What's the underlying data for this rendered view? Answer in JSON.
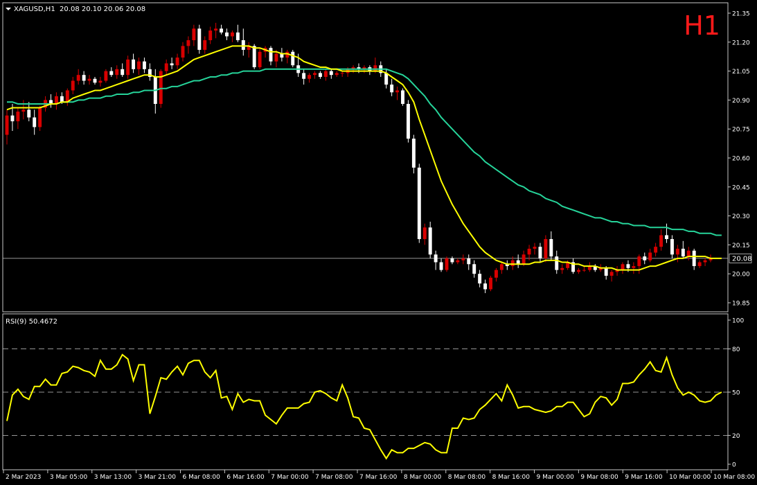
{
  "header": {
    "symbol_info": "XAGUSD,H1  20.08 20.10 20.06 20.08"
  },
  "timeframe_label": "H1",
  "rsi_header": "RSI(9) 50.4672",
  "colors": {
    "background": "#000000",
    "frame": "#c8c8c8",
    "text": "#ffffff",
    "bull_candle": "#d80000",
    "bear_candle": "#ffffff",
    "ma_fast": "#ffff00",
    "ma_slow": "#26d49a",
    "rsi_line": "#ffff00",
    "timeframe_label": "#ff1a1a",
    "price_line": "#c8c8c8"
  },
  "chart_data": [
    {
      "type": "candlestick",
      "symbol": "XAGUSD",
      "timeframe": "H1",
      "ylim": [
        19.78,
        21.42
      ],
      "y_ticks": [
        "21.35",
        "21.20",
        "21.05",
        "20.90",
        "20.75",
        "20.60",
        "20.45",
        "20.30",
        "20.15",
        "20.00",
        "19.85"
      ],
      "current_price": "20.08",
      "x_labels": [
        "2 Mar 2023",
        "3 Mar 05:00",
        "3 Mar 13:00",
        "3 Mar 21:00",
        "6 Mar 08:00",
        "6 Mar 16:00",
        "7 Mar 00:00",
        "7 Mar 08:00",
        "7 Mar 16:00",
        "8 Mar 00:00",
        "8 Mar 08:00",
        "8 Mar 16:00",
        "9 Mar 00:00",
        "9 Mar 08:00",
        "9 Mar 16:00",
        "10 Mar 00:00",
        "10 Mar 08:00"
      ],
      "candles": [
        [
          20.72,
          20.85,
          20.67,
          20.82
        ],
        [
          20.82,
          20.88,
          20.74,
          20.79
        ],
        [
          20.79,
          20.86,
          20.75,
          20.84
        ],
        [
          20.84,
          20.9,
          20.8,
          20.85
        ],
        [
          20.85,
          20.89,
          20.79,
          20.81
        ],
        [
          20.81,
          20.85,
          20.72,
          20.76
        ],
        [
          20.76,
          20.87,
          20.74,
          20.86
        ],
        [
          20.86,
          20.92,
          20.84,
          20.9
        ],
        [
          20.9,
          20.93,
          20.86,
          20.88
        ],
        [
          20.88,
          20.94,
          20.85,
          20.92
        ],
        [
          20.92,
          20.94,
          20.88,
          20.89
        ],
        [
          20.89,
          20.96,
          20.87,
          20.95
        ],
        [
          20.95,
          21.02,
          20.93,
          21.0
        ],
        [
          21.0,
          21.06,
          20.98,
          21.03
        ],
        [
          21.03,
          21.05,
          20.98,
          21.0
        ],
        [
          21.0,
          21.03,
          20.98,
          21.01
        ],
        [
          21.01,
          21.02,
          20.98,
          20.99
        ],
        [
          20.99,
          21.02,
          20.97,
          21.0
        ],
        [
          21.0,
          21.06,
          20.99,
          21.05
        ],
        [
          21.05,
          21.07,
          21.02,
          21.03
        ],
        [
          21.03,
          21.08,
          21.01,
          21.06
        ],
        [
          21.06,
          21.09,
          21.02,
          21.03
        ],
        [
          21.03,
          21.13,
          21.01,
          21.11
        ],
        [
          21.11,
          21.14,
          21.04,
          21.06
        ],
        [
          21.06,
          21.12,
          21.03,
          21.1
        ],
        [
          21.1,
          21.12,
          21.04,
          21.06
        ],
        [
          21.06,
          21.09,
          21.0,
          21.02
        ],
        [
          21.02,
          21.06,
          20.83,
          20.88
        ],
        [
          20.88,
          21.06,
          20.86,
          21.05
        ],
        [
          21.05,
          21.11,
          21.03,
          21.09
        ],
        [
          21.09,
          21.12,
          21.06,
          21.08
        ],
        [
          21.08,
          21.14,
          21.06,
          21.12
        ],
        [
          21.12,
          21.2,
          21.1,
          21.18
        ],
        [
          21.18,
          21.23,
          21.14,
          21.21
        ],
        [
          21.21,
          21.29,
          21.18,
          21.27
        ],
        [
          21.27,
          21.29,
          21.14,
          21.16
        ],
        [
          21.16,
          21.23,
          21.14,
          21.21
        ],
        [
          21.21,
          21.28,
          21.19,
          21.26
        ],
        [
          21.26,
          21.3,
          21.22,
          21.27
        ],
        [
          21.27,
          21.29,
          21.24,
          21.25
        ],
        [
          21.25,
          21.27,
          21.21,
          21.23
        ],
        [
          21.23,
          21.26,
          21.2,
          21.25
        ],
        [
          21.25,
          21.29,
          21.2,
          21.21
        ],
        [
          21.21,
          21.27,
          21.13,
          21.16
        ],
        [
          21.16,
          21.2,
          21.12,
          21.18
        ],
        [
          21.18,
          21.19,
          21.06,
          21.07
        ],
        [
          21.07,
          21.17,
          21.06,
          21.15
        ],
        [
          21.15,
          21.18,
          21.12,
          21.17
        ],
        [
          21.17,
          21.18,
          21.08,
          21.1
        ],
        [
          21.1,
          21.16,
          21.07,
          21.14
        ],
        [
          21.14,
          21.17,
          21.1,
          21.12
        ],
        [
          21.12,
          21.16,
          21.09,
          21.15
        ],
        [
          21.15,
          21.16,
          21.07,
          21.08
        ],
        [
          21.08,
          21.14,
          21.02,
          21.04
        ],
        [
          21.04,
          21.06,
          20.98,
          21.01
        ],
        [
          21.01,
          21.04,
          20.99,
          21.03
        ],
        [
          21.03,
          21.05,
          21.01,
          21.04
        ],
        [
          21.04,
          21.05,
          21.01,
          21.02
        ],
        [
          21.02,
          21.06,
          21.0,
          21.05
        ],
        [
          21.05,
          21.06,
          21.01,
          21.03
        ],
        [
          21.03,
          21.05,
          21.02,
          21.04
        ],
        [
          21.04,
          21.05,
          21.02,
          21.04
        ],
        [
          21.04,
          21.07,
          21.02,
          21.06
        ],
        [
          21.06,
          21.08,
          21.04,
          21.07
        ],
        [
          21.07,
          21.09,
          21.04,
          21.06
        ],
        [
          21.06,
          21.08,
          21.04,
          21.07
        ],
        [
          21.07,
          21.08,
          21.03,
          21.05
        ],
        [
          21.05,
          21.12,
          21.04,
          21.08
        ],
        [
          21.08,
          21.1,
          21.02,
          21.04
        ],
        [
          21.04,
          21.06,
          20.96,
          20.98
        ],
        [
          20.98,
          21.01,
          20.92,
          20.94
        ],
        [
          20.94,
          20.97,
          20.9,
          20.95
        ],
        [
          20.95,
          20.96,
          20.87,
          20.88
        ],
        [
          20.88,
          20.9,
          20.68,
          20.7
        ],
        [
          20.7,
          20.72,
          20.52,
          20.55
        ],
        [
          20.55,
          20.57,
          20.16,
          20.18
        ],
        [
          20.18,
          20.26,
          20.15,
          20.24
        ],
        [
          20.24,
          20.27,
          20.08,
          20.1
        ],
        [
          20.1,
          20.12,
          20.02,
          20.06
        ],
        [
          20.06,
          20.08,
          20.01,
          20.02
        ],
        [
          20.02,
          20.09,
          20.01,
          20.08
        ],
        [
          20.08,
          20.09,
          20.05,
          20.06
        ],
        [
          20.06,
          20.08,
          20.05,
          20.07
        ],
        [
          20.07,
          20.1,
          20.05,
          20.08
        ],
        [
          20.08,
          20.1,
          20.02,
          20.05
        ],
        [
          20.05,
          20.07,
          19.98,
          20.0
        ],
        [
          20.0,
          20.02,
          19.93,
          19.95
        ],
        [
          19.95,
          19.97,
          19.9,
          19.92
        ],
        [
          19.92,
          19.99,
          19.91,
          19.98
        ],
        [
          19.98,
          20.03,
          19.96,
          20.02
        ],
        [
          20.02,
          20.06,
          20.0,
          20.05
        ],
        [
          20.05,
          20.07,
          20.02,
          20.04
        ],
        [
          20.04,
          20.09,
          20.02,
          20.07
        ],
        [
          20.07,
          20.1,
          20.03,
          20.05
        ],
        [
          20.05,
          20.12,
          20.04,
          20.1
        ],
        [
          20.1,
          20.15,
          20.07,
          20.13
        ],
        [
          20.13,
          20.16,
          20.1,
          20.14
        ],
        [
          20.14,
          20.16,
          20.06,
          20.08
        ],
        [
          20.08,
          20.2,
          20.06,
          20.18
        ],
        [
          20.18,
          20.22,
          20.07,
          20.09
        ],
        [
          20.09,
          20.12,
          20.0,
          20.02
        ],
        [
          20.02,
          20.05,
          20.0,
          20.03
        ],
        [
          20.03,
          20.07,
          20.02,
          20.06
        ],
        [
          20.06,
          20.08,
          20.0,
          20.01
        ],
        [
          20.01,
          20.03,
          20.0,
          20.02
        ],
        [
          20.02,
          20.04,
          20.01,
          20.02
        ],
        [
          20.02,
          20.06,
          20.01,
          20.04
        ],
        [
          20.04,
          20.05,
          20.01,
          20.02
        ],
        [
          20.02,
          20.05,
          20.01,
          20.03
        ],
        [
          20.03,
          20.04,
          19.97,
          19.99
        ],
        [
          19.99,
          20.02,
          19.96,
          20.01
        ],
        [
          20.01,
          20.04,
          19.99,
          20.02
        ],
        [
          20.02,
          20.06,
          20.0,
          20.05
        ],
        [
          20.05,
          20.07,
          20.01,
          20.03
        ],
        [
          20.03,
          20.06,
          20.0,
          20.04
        ],
        [
          20.04,
          20.1,
          20.0,
          20.09
        ],
        [
          20.09,
          20.11,
          20.05,
          20.07
        ],
        [
          20.07,
          20.13,
          20.06,
          20.11
        ],
        [
          20.11,
          20.16,
          20.09,
          20.14
        ],
        [
          20.14,
          20.23,
          20.12,
          20.2
        ],
        [
          20.2,
          20.26,
          20.16,
          20.18
        ],
        [
          20.18,
          20.2,
          20.08,
          20.1
        ],
        [
          20.1,
          20.15,
          20.06,
          20.13
        ],
        [
          20.13,
          20.17,
          20.08,
          20.09
        ],
        [
          20.09,
          20.14,
          20.07,
          20.12
        ],
        [
          20.12,
          20.13,
          20.02,
          20.04
        ],
        [
          20.04,
          20.07,
          20.03,
          20.06
        ],
        [
          20.06,
          20.08,
          20.04,
          20.07
        ],
        [
          20.07,
          20.1,
          20.06,
          20.08
        ]
      ],
      "ma_fast": [
        20.85,
        20.86,
        20.86,
        20.86,
        20.86,
        20.86,
        20.86,
        20.87,
        20.88,
        20.88,
        20.89,
        20.89,
        20.91,
        20.92,
        20.93,
        20.94,
        20.95,
        20.95,
        20.96,
        20.97,
        20.98,
        20.99,
        21.0,
        21.01,
        21.02,
        21.03,
        21.03,
        21.02,
        21.02,
        21.03,
        21.04,
        21.05,
        21.07,
        21.09,
        21.11,
        21.12,
        21.13,
        21.14,
        21.15,
        21.16,
        21.17,
        21.18,
        21.18,
        21.18,
        21.18,
        21.17,
        21.17,
        21.16,
        21.15,
        21.15,
        21.14,
        21.14,
        21.13,
        21.12,
        21.1,
        21.09,
        21.08,
        21.07,
        21.07,
        21.06,
        21.06,
        21.05,
        21.05,
        21.05,
        21.05,
        21.05,
        21.05,
        21.05,
        21.05,
        21.04,
        21.02,
        21.0,
        20.98,
        20.94,
        20.89,
        20.8,
        20.72,
        20.64,
        20.56,
        20.48,
        20.42,
        20.36,
        20.31,
        20.26,
        20.22,
        20.18,
        20.14,
        20.11,
        20.09,
        20.07,
        20.06,
        20.05,
        20.05,
        20.05,
        20.05,
        20.05,
        20.06,
        20.06,
        20.07,
        20.07,
        20.07,
        20.06,
        20.06,
        20.05,
        20.05,
        20.04,
        20.04,
        20.04,
        20.03,
        20.03,
        20.03,
        20.02,
        20.02,
        20.02,
        20.02,
        20.02,
        20.03,
        20.04,
        20.04,
        20.05,
        20.06,
        20.07,
        20.08,
        20.08,
        20.09,
        20.09,
        20.09,
        20.09,
        20.08,
        20.08,
        20.08
      ],
      "ma_slow": [
        20.89,
        20.89,
        20.88,
        20.88,
        20.88,
        20.88,
        20.88,
        20.88,
        20.88,
        20.88,
        20.89,
        20.89,
        20.89,
        20.9,
        20.9,
        20.91,
        20.91,
        20.91,
        20.92,
        20.92,
        20.93,
        20.93,
        20.93,
        20.94,
        20.94,
        20.95,
        20.95,
        20.95,
        20.96,
        20.96,
        20.97,
        20.97,
        20.98,
        20.99,
        21.0,
        21.0,
        21.01,
        21.02,
        21.02,
        21.03,
        21.03,
        21.04,
        21.04,
        21.05,
        21.05,
        21.05,
        21.05,
        21.06,
        21.06,
        21.06,
        21.06,
        21.06,
        21.06,
        21.06,
        21.06,
        21.06,
        21.06,
        21.06,
        21.06,
        21.06,
        21.06,
        21.06,
        21.06,
        21.06,
        21.06,
        21.06,
        21.06,
        21.06,
        21.06,
        21.06,
        21.05,
        21.04,
        21.03,
        21.01,
        20.98,
        20.95,
        20.92,
        20.88,
        20.85,
        20.81,
        20.78,
        20.75,
        20.72,
        20.69,
        20.66,
        20.63,
        20.61,
        20.58,
        20.56,
        20.54,
        20.52,
        20.5,
        20.48,
        20.46,
        20.45,
        20.43,
        20.42,
        20.41,
        20.39,
        20.38,
        20.37,
        20.35,
        20.34,
        20.33,
        20.32,
        20.31,
        20.3,
        20.29,
        20.29,
        20.28,
        20.27,
        20.27,
        20.26,
        20.26,
        20.25,
        20.25,
        20.25,
        20.24,
        20.24,
        20.24,
        20.24,
        20.23,
        20.23,
        20.23,
        20.22,
        20.22,
        20.21,
        20.21,
        20.21,
        20.2,
        20.2
      ]
    },
    {
      "type": "line",
      "name": "RSI(9)",
      "ylim": [
        0,
        100
      ],
      "y_ticks": [
        "100",
        "80",
        "50",
        "20",
        "0"
      ],
      "levels": [
        80,
        50,
        20
      ],
      "values": [
        30,
        48,
        52,
        47,
        45,
        54,
        54,
        59,
        55,
        55,
        63,
        64,
        68,
        67,
        65,
        64,
        61,
        72,
        66,
        66,
        69,
        76,
        73,
        58,
        69,
        69,
        35,
        47,
        60,
        59,
        64,
        68,
        62,
        70,
        72,
        72,
        64,
        60,
        65,
        46,
        47,
        38,
        49,
        43,
        45,
        44,
        44,
        34,
        31,
        28,
        34,
        39,
        39,
        39,
        42,
        43,
        50,
        51,
        49,
        46,
        44,
        55,
        46,
        33,
        32,
        25,
        24,
        17,
        10,
        4,
        10,
        8,
        8,
        11,
        11,
        13,
        15,
        14,
        10,
        8,
        8,
        25,
        25,
        32,
        31,
        32,
        38,
        41,
        45,
        49,
        44,
        55,
        48,
        39,
        40,
        40,
        38,
        37,
        36,
        37,
        40,
        40,
        43,
        43,
        38,
        33,
        35,
        43,
        47,
        46,
        41,
        45,
        56,
        56,
        57,
        62,
        66,
        71,
        65,
        64,
        74,
        62,
        53,
        48,
        50,
        48,
        44,
        43,
        44,
        48,
        50
      ]
    }
  ]
}
